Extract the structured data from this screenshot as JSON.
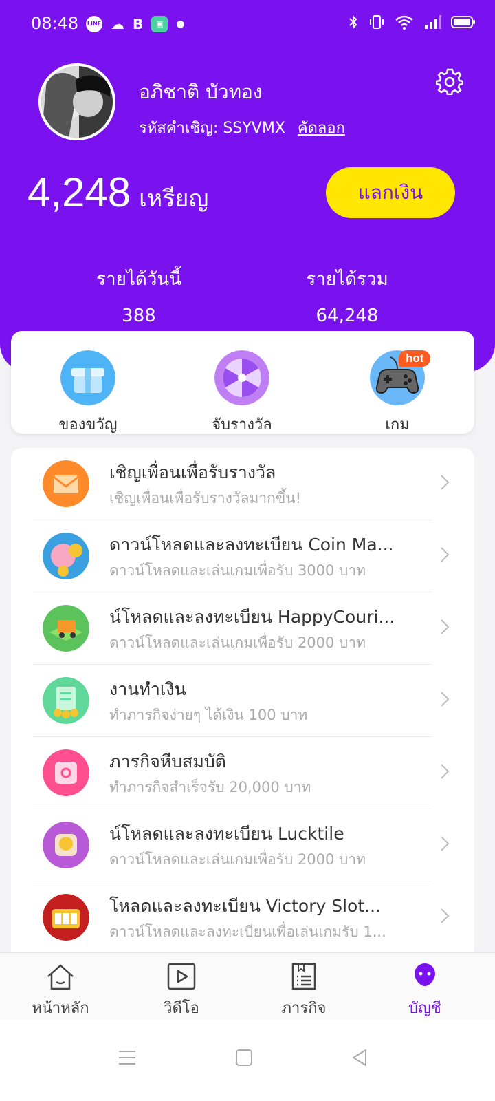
{
  "status_bar": {
    "time": "08:48",
    "notification_icons": [
      "line-icon",
      "discord-icon",
      "bold-b-icon",
      "app-icon",
      "dot-icon"
    ],
    "right_icons": [
      "bluetooth-icon",
      "vibrate-icon",
      "wifi-icon",
      "signal-icon",
      "battery-icon"
    ]
  },
  "profile": {
    "name": "อภิชาติ บัวทอง",
    "invite_label": "รหัสคำเชิญ: SSYVMX",
    "copy_label": "คัดลอก"
  },
  "balance": {
    "value": "4,248",
    "unit": "เหรียญ",
    "exchange_label": "แลกเงิน"
  },
  "stats": {
    "today_label": "รายได้วันนี้",
    "today_value": "388",
    "total_label": "รายได้รวม",
    "total_value": "64,248"
  },
  "shortcuts": [
    {
      "label": "ของขวัญ",
      "icon": "gift-icon"
    },
    {
      "label": "จับรางวัล",
      "icon": "spin-wheel-icon"
    },
    {
      "label": "เกม",
      "icon": "gamepad-icon",
      "badge": "hot"
    }
  ],
  "tasks": [
    {
      "title": "เชิญเพื่อนเพื่อรับรางวัล",
      "subtitle": "เชิญเพื่อนเพื่อรับรางวัลมากขึ้น!",
      "icon": "invite-envelope-icon"
    },
    {
      "title": "ดาวน์โหลดและลงทะเบียน Coin Ma...",
      "subtitle": "ดาวน์โหลดและเล่นเกมเพื่อรับ 3000 บาท",
      "icon": "coin-pig-game-icon"
    },
    {
      "title": "น์โหลดและลงทะเบียน HappyCouri...",
      "subtitle": "ดาวน์โหลดและเล่นเกมเพื่อรับ 2000 บาท",
      "icon": "truck-game-icon"
    },
    {
      "title": "งานทำเงิน",
      "subtitle": "ทำภารกิจง่ายๆ ได้เงิน 100 บาท",
      "icon": "money-task-icon"
    },
    {
      "title": "ภารกิจหีบสมบัติ",
      "subtitle": "ทำภารกิจสำเร็จรับ 20,000 บาท",
      "icon": "treasure-chest-icon"
    },
    {
      "title": "น์โหลดและลงทะเบียน Lucktile",
      "subtitle": "ดาวน์โหลดและเล่นเกมเพื่อรับ 2000 บาท",
      "icon": "lucktile-game-icon"
    },
    {
      "title": "โหลดและลงทะเบียน Victory Slot...",
      "subtitle": "ดาวน์โหลดและลงทะเบียนเพื่อเล่นเกมรับ 1...",
      "icon": "slot-machine-icon"
    }
  ],
  "bottom_nav": [
    {
      "label": "หน้าหลัก",
      "icon": "home-icon",
      "active": false
    },
    {
      "label": "วิดีโอ",
      "icon": "video-play-icon",
      "active": false
    },
    {
      "label": "ภารกิจ",
      "icon": "task-list-icon",
      "active": false
    },
    {
      "label": "บัญชี",
      "icon": "account-icon",
      "active": true
    }
  ],
  "colors": {
    "primary": "#7a12f0",
    "accent_button": "#ffe600",
    "hot_badge": "#ff5a1f"
  }
}
